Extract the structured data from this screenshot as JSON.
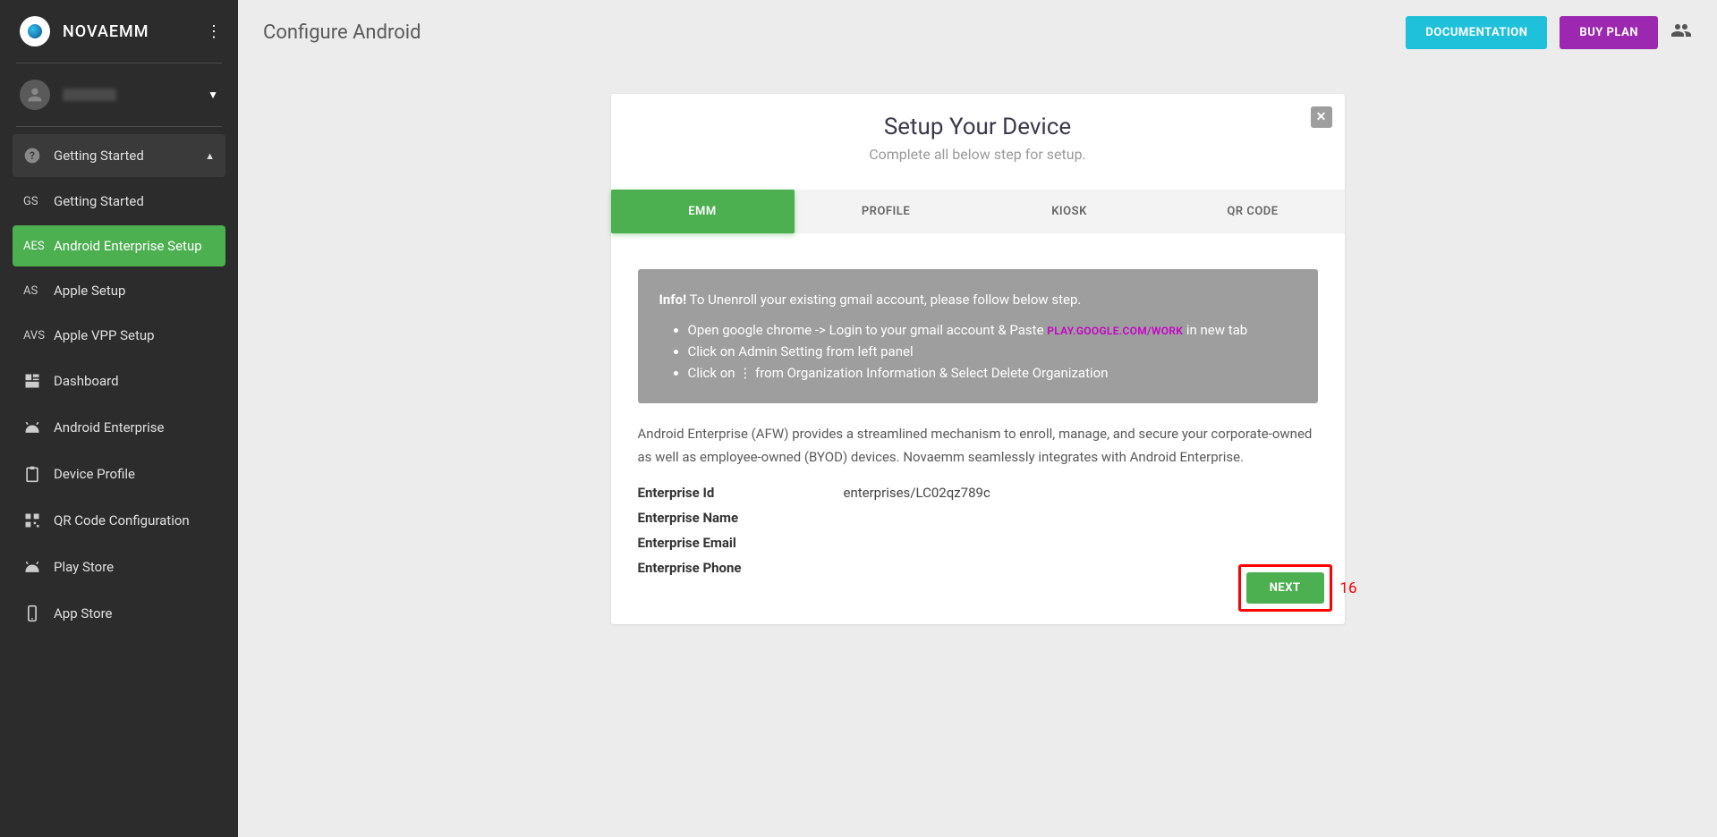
{
  "brand": {
    "name": "NOVAEMM"
  },
  "sidebar": {
    "group": {
      "label": "Getting Started"
    },
    "items": [
      {
        "abbr": "GS",
        "label": "Getting Started"
      },
      {
        "abbr": "AES",
        "label": "Android Enterprise Setup"
      },
      {
        "abbr": "AS",
        "label": "Apple Setup"
      },
      {
        "abbr": "AVS",
        "label": "Apple VPP Setup"
      }
    ],
    "main": [
      {
        "label": "Dashboard"
      },
      {
        "label": "Android Enterprise"
      },
      {
        "label": "Device Profile"
      },
      {
        "label": "QR Code Configuration"
      },
      {
        "label": "Play Store"
      },
      {
        "label": "App Store"
      }
    ]
  },
  "header": {
    "title": "Configure Android",
    "doc_btn": "DOCUMENTATION",
    "plan_btn": "BUY PLAN"
  },
  "card": {
    "title": "Setup Your Device",
    "subtitle": "Complete all below step for setup.",
    "tabs": [
      "EMM",
      "PROFILE",
      "KIOSK",
      "QR CODE"
    ],
    "info": {
      "prefix": "Info!",
      "lead": "To Unenroll your existing gmail account, please follow below step.",
      "steps": {
        "s1a": "Open google chrome -> Login to your gmail account & Paste ",
        "s1_link": "PLAY.GOOGLE.COM/WORK",
        "s1b": " in new tab",
        "s2": "Click on Admin Setting from left panel",
        "s3": "Click on ⋮ from Organization Information & Select Delete Organization"
      }
    },
    "description": "Android Enterprise (AFW) provides a streamlined mechanism to enroll, manage, and secure your corporate-owned as well as employee-owned (BYOD) devices. Novaemm seamlessly integrates with Android Enterprise.",
    "fields": {
      "id_label": "Enterprise Id",
      "id_value": "enterprises/LC02qz789c",
      "name_label": "Enterprise Name",
      "name_value": "",
      "email_label": "Enterprise Email",
      "email_value": "",
      "phone_label": "Enterprise Phone",
      "phone_value": ""
    },
    "next": "NEXT",
    "callout": "16"
  }
}
